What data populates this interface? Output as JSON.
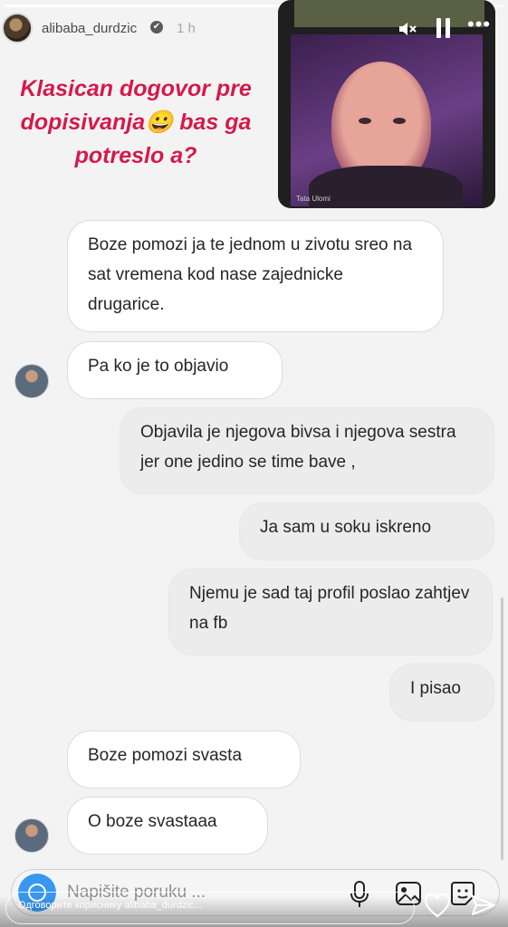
{
  "story": {
    "progress": 0.85,
    "username": "alibaba_durdzic",
    "verified_glyph": "✔",
    "time": "1 h",
    "caption": "Klasican dogovor pre dopisivanja😀 bas ga potreslo a?",
    "video_name": "Tata Ulomi"
  },
  "icons": {
    "mute": "speaker-muted-icon",
    "pause": "pause-icon",
    "more": "more-icon"
  },
  "chat": {
    "messages": [
      {
        "side": "in",
        "text": "Boze pomozi ja te jednom u zivotu sreo na sat vremena kod nase zajednicke drugarice."
      },
      {
        "side": "in",
        "text": "Pa ko je to objavio"
      },
      {
        "side": "out",
        "text": "Objavila je njegova bivsa i njegova sestra jer one jedino se time bave ,"
      },
      {
        "side": "out",
        "text": "Ja sam u soku iskreno"
      },
      {
        "side": "out",
        "text": "Njemu je sad taj profil poslao zahtjev na fb"
      },
      {
        "side": "out",
        "text": "I pisao"
      },
      {
        "side": "in",
        "text": "Boze pomozi svasta"
      },
      {
        "side": "in",
        "text": "O boze svastaaa"
      }
    ],
    "composer_placeholder": "Napišite poruku ...",
    "reply_placeholder": "Одговорите кориснику alibaba_durdzic..."
  },
  "colors": {
    "caption": "#d41a4a",
    "camera_button": "#3897f0"
  }
}
